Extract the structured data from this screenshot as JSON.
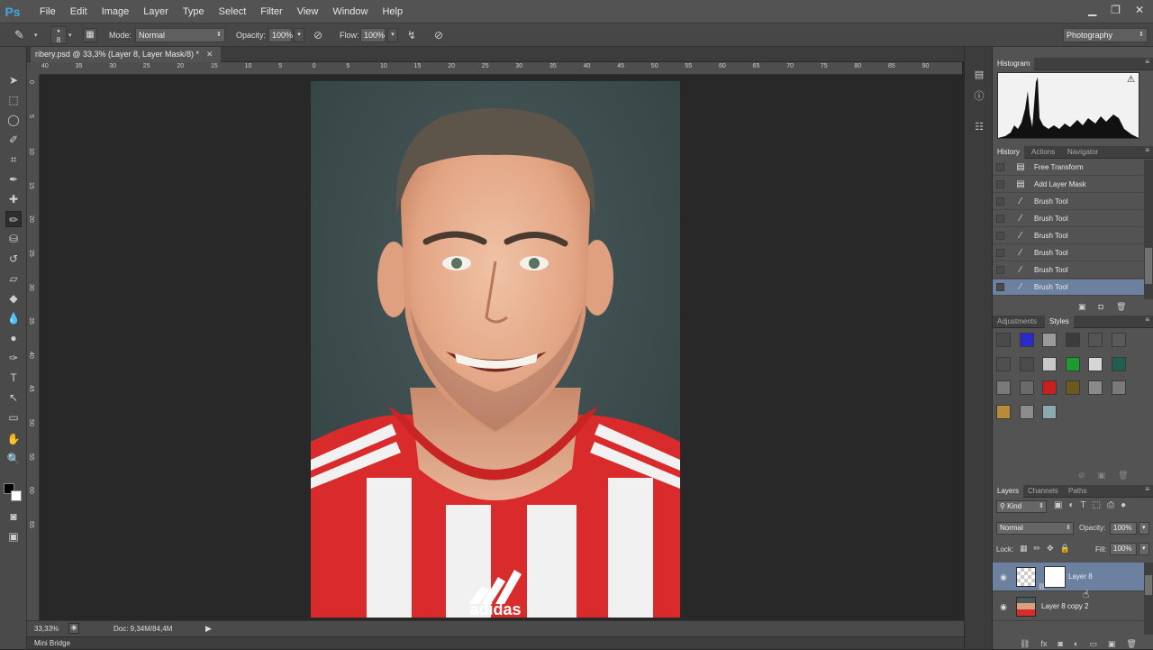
{
  "app": {
    "logo": "Ps"
  },
  "menu": [
    "File",
    "Edit",
    "Image",
    "Layer",
    "Type",
    "Select",
    "Filter",
    "View",
    "Window",
    "Help"
  ],
  "window_controls": [
    "minimize-icon",
    "restore-icon",
    "close-icon"
  ],
  "options_bar": {
    "brush_size": "8",
    "mode_label": "Mode:",
    "mode_value": "Normal",
    "opacity_label": "Opacity:",
    "opacity_value": "100%",
    "flow_label": "Flow:",
    "flow_value": "100%",
    "workspace": "Photography"
  },
  "document": {
    "tab_title": "ribery.psd @ 33,3% (Layer 8, Layer Mask/8) *",
    "zoom": "33,33%",
    "doc_info": "Doc: 9,34M/84,4M",
    "ruler_h": [
      "40",
      "35",
      "30",
      "25",
      "20",
      "15",
      "10",
      "5",
      "0",
      "5",
      "10",
      "15",
      "20",
      "25",
      "30",
      "35",
      "40",
      "45",
      "50",
      "55",
      "60",
      "65",
      "70",
      "75",
      "80",
      "85",
      "90"
    ],
    "ruler_v": [
      "0",
      "5",
      "10",
      "15",
      "20",
      "25",
      "30",
      "35",
      "40",
      "45",
      "50",
      "55",
      "60",
      "65"
    ],
    "jersey_text": "adidas"
  },
  "mini_bridge": "Mini Bridge",
  "histogram_panel": {
    "tab": "Histogram",
    "warning": "⚠"
  },
  "history_panel": {
    "tabs": [
      "History",
      "Actions",
      "Navigator"
    ],
    "items": [
      {
        "label": "Free Transform",
        "icon": "document-icon",
        "selected": false
      },
      {
        "label": "Add Layer Mask",
        "icon": "document-icon",
        "selected": false
      },
      {
        "label": "Brush Tool",
        "icon": "brush-icon",
        "selected": false
      },
      {
        "label": "Brush Tool",
        "icon": "brush-icon",
        "selected": false
      },
      {
        "label": "Brush Tool",
        "icon": "brush-icon",
        "selected": false
      },
      {
        "label": "Brush Tool",
        "icon": "brush-icon",
        "selected": false
      },
      {
        "label": "Brush Tool",
        "icon": "brush-icon",
        "selected": false
      },
      {
        "label": "Brush Tool",
        "icon": "brush-icon",
        "selected": true
      }
    ]
  },
  "styles_panel": {
    "tabs": [
      "Adjustments",
      "Styles"
    ],
    "swatch_colors": [
      "#4a4a4a",
      "#2a2ac8",
      "#9a9a9a",
      "#3c3c3c",
      "#555555",
      "#5a5a5a",
      "#505050",
      "#4c4c4c",
      "#c8c8c8",
      "#1f9a2e",
      "#d6d6d6",
      "#1f5e50",
      "#7a7a7a",
      "#6a6a6a",
      "#c82020",
      "#6a5a20",
      "#8a8a8a",
      "#7a7a7a",
      "#b88a3a",
      "#8c8c8c",
      "#8aaab0"
    ]
  },
  "layers_panel": {
    "tabs": [
      "Layers",
      "Channels",
      "Paths"
    ],
    "kind": "Kind",
    "blend_mode": "Normal",
    "opacity_label": "Opacity:",
    "opacity_value": "100%",
    "lock_label": "Lock:",
    "fill_label": "Fill:",
    "fill_value": "100%",
    "layers": [
      {
        "name": "Layer 8",
        "selected": true
      },
      {
        "name": "Layer 8 copy 2",
        "selected": false
      }
    ]
  }
}
